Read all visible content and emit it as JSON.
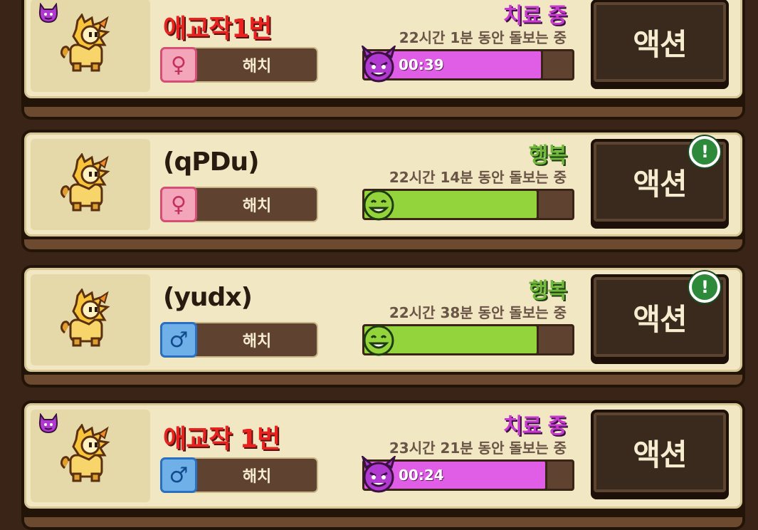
{
  "pets": [
    {
      "name": "애교작1번",
      "name_color": "red",
      "has_devil_badge": true,
      "gender": "female",
      "gender_symbol": "♀",
      "stage": "해치",
      "status": "치료 중",
      "status_type": "healing",
      "care_time": "22시간 1분 동안 돌보는 중",
      "bar_time": "00:39",
      "bar_fill": 0.85,
      "bar_emoji": "devil-face",
      "action_label": "액션",
      "has_notice": false
    },
    {
      "name": "(qPDu)",
      "name_color": "dark",
      "has_devil_badge": false,
      "gender": "female",
      "gender_symbol": "♀",
      "stage": "해치",
      "status": "행복",
      "status_type": "happy",
      "care_time": "22시간 14분 동안 돌보는 중",
      "bar_time": "",
      "bar_fill": 0.83,
      "bar_emoji": "smile-face",
      "action_label": "액션",
      "has_notice": true,
      "notice_symbol": "!"
    },
    {
      "name": "(yudx)",
      "name_color": "dark",
      "has_devil_badge": false,
      "gender": "male",
      "gender_symbol": "♂",
      "stage": "해치",
      "status": "행복",
      "status_type": "happy",
      "care_time": "22시간 38분 동안 돌보는 중",
      "bar_time": "",
      "bar_fill": 0.83,
      "bar_emoji": "smile-face",
      "action_label": "액션",
      "has_notice": true,
      "notice_symbol": "!"
    },
    {
      "name": "애교작 1번",
      "name_color": "red",
      "has_devil_badge": true,
      "gender": "male",
      "gender_symbol": "♂",
      "stage": "해치",
      "status": "치료 중",
      "status_type": "healing",
      "care_time": "23시간 21분 동안 돌보는 중",
      "bar_time": "00:24",
      "bar_fill": 0.87,
      "bar_emoji": "devil-face",
      "action_label": "액션",
      "has_notice": false
    }
  ],
  "colors": {
    "healing": "#c63ad0",
    "happy": "#6fb83a",
    "bar_pink": "#e05de6",
    "bar_green": "#93d43c",
    "name_red": "#e8231f"
  }
}
